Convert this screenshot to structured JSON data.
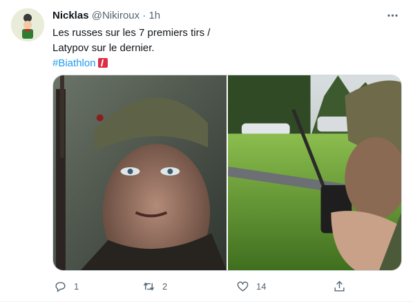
{
  "author": {
    "name": "Nicklas",
    "handle": "@Nikiroux",
    "separator": "·",
    "time": "1h"
  },
  "tweet": {
    "line1": "Les russes sur les 7 premiers tirs /",
    "line2": "Latypov sur le dernier.",
    "hashtag": "#Biathlon"
  },
  "icons": {
    "more": "more-icon",
    "reply": "reply-icon",
    "retweet": "retweet-icon",
    "like": "like-icon",
    "share": "share-icon",
    "hashtag_emoji": "biathlon-flag-emoji"
  },
  "actions": {
    "reply_count": "1",
    "retweet_count": "2",
    "like_count": "14"
  },
  "colors": {
    "link": "#1d9bf0",
    "secondary_text": "#536471",
    "primary_text": "#0f1419"
  }
}
